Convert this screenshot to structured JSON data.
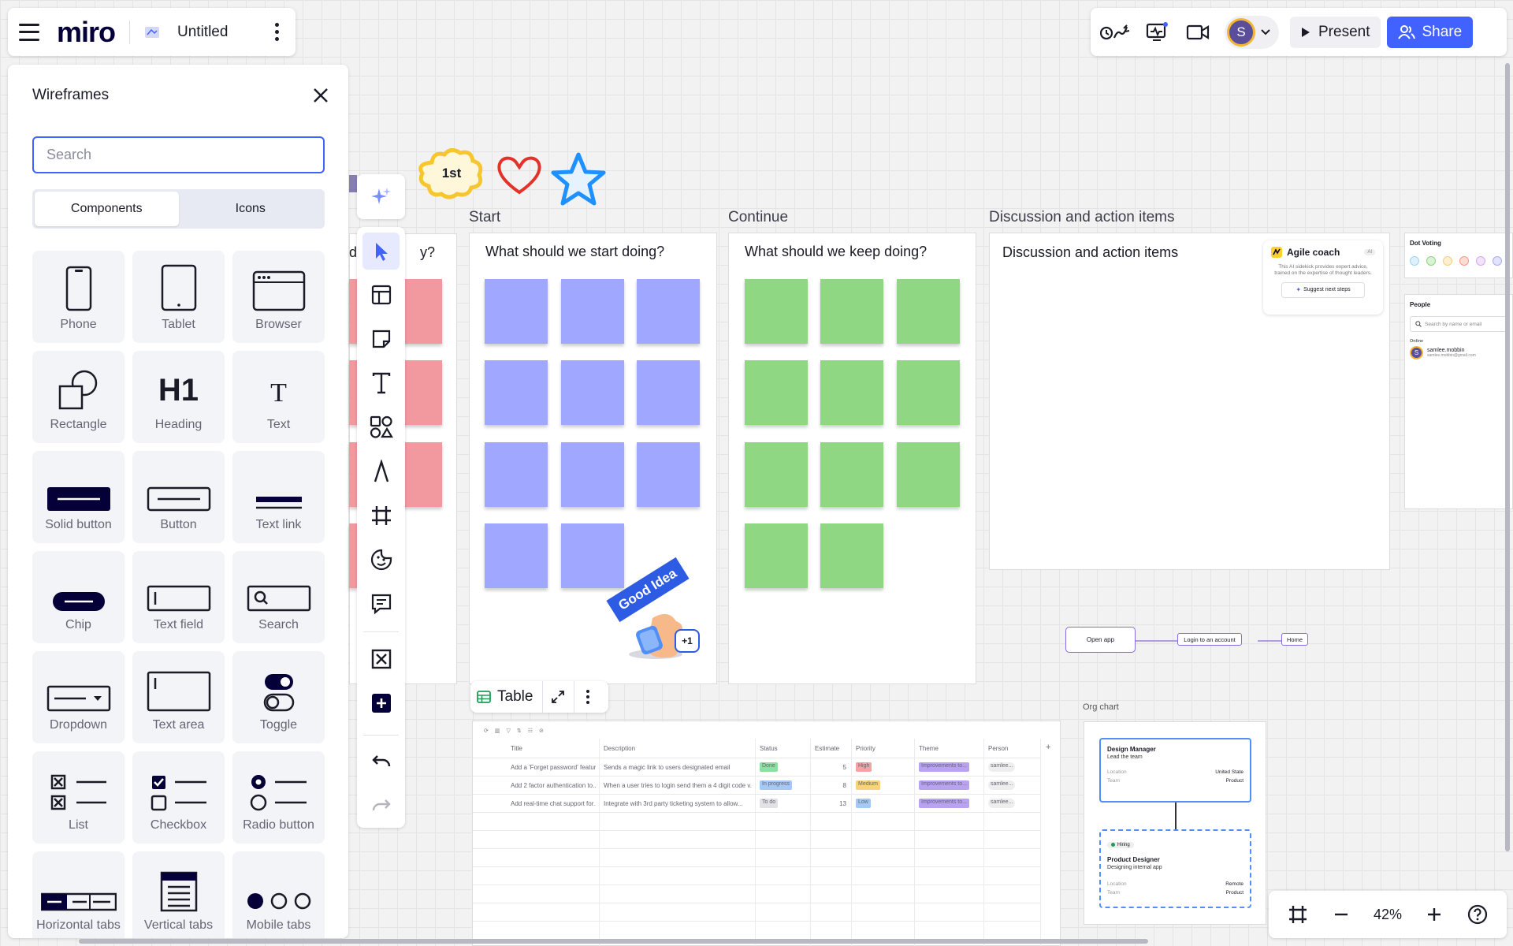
{
  "app": {
    "logo": "miro",
    "board_title": "Untitled"
  },
  "topbar": {
    "present_label": "Present",
    "share_label": "Share",
    "avatar_initial": "S"
  },
  "panel": {
    "title": "Wireframes",
    "search_placeholder": "Search",
    "tabs": [
      "Components",
      "Icons"
    ],
    "active_tab": "Components",
    "components": [
      {
        "label": "Phone",
        "icon": "phone-icon"
      },
      {
        "label": "Tablet",
        "icon": "tablet-icon"
      },
      {
        "label": "Browser",
        "icon": "browser-icon"
      },
      {
        "label": "Rectangle",
        "icon": "rectangle-icon"
      },
      {
        "label": "Heading",
        "icon": "heading-icon"
      },
      {
        "label": "Text",
        "icon": "text-icon"
      },
      {
        "label": "Solid button",
        "icon": "solid-button-icon"
      },
      {
        "label": "Button",
        "icon": "button-icon"
      },
      {
        "label": "Text link",
        "icon": "text-link-icon"
      },
      {
        "label": "Chip",
        "icon": "chip-icon"
      },
      {
        "label": "Text field",
        "icon": "text-field-icon"
      },
      {
        "label": "Search",
        "icon": "search-field-icon"
      },
      {
        "label": "Dropdown",
        "icon": "dropdown-icon"
      },
      {
        "label": "Text area",
        "icon": "text-area-icon"
      },
      {
        "label": "Toggle",
        "icon": "toggle-icon"
      },
      {
        "label": "List",
        "icon": "list-icon"
      },
      {
        "label": "Checkbox",
        "icon": "checkbox-icon"
      },
      {
        "label": "Radio button",
        "icon": "radio-button-icon"
      },
      {
        "label": "Horizontal tabs",
        "icon": "horizontal-tabs-icon"
      },
      {
        "label": "Vertical tabs",
        "icon": "vertical-tabs-icon"
      },
      {
        "label": "Mobile tabs",
        "icon": "mobile-tabs-icon"
      }
    ],
    "heading_glyph": "H1",
    "text_glyph": "T"
  },
  "canvas": {
    "partial_frame_heading": "d                y?",
    "stickers": {
      "first": "1st"
    },
    "frames": [
      {
        "title": "Start",
        "heading": "What should we start doing?"
      },
      {
        "title": "Continue",
        "heading": "What should we keep doing?"
      },
      {
        "title": "Discussion and action items",
        "heading": "Discussion and action items"
      }
    ],
    "good_idea": {
      "text": "Good Idea",
      "count": "+1"
    },
    "agile_coach": {
      "title": "Agile coach",
      "badge": "AI",
      "desc": "This AI sidekick provides expert advice, trained on the expertise of thought leaders.",
      "button": "Suggest next steps"
    },
    "dot_voting": {
      "title": "Dot Voting",
      "colors": [
        "#9fd3f5",
        "#8fd782",
        "#f7cf7a",
        "#f59a7f",
        "#d7a8f0",
        "#a9aaf5"
      ]
    },
    "people": {
      "title": "People",
      "search_placeholder": "Search by name or email",
      "online_label": "Online",
      "user_name": "samlee.mobbin",
      "user_email": "samlee.mobbin@gmail.com"
    },
    "flow": [
      "Open app",
      "Login to an account",
      "Home"
    ],
    "org_chart": {
      "label": "Org chart",
      "manager": {
        "title": "Design Manager",
        "subtitle": "Lead the team",
        "location_label": "Location",
        "location": "United State",
        "team_label": "Team",
        "team": "Product"
      },
      "designer": {
        "badge": "Hiring",
        "title": "Product Designer",
        "subtitle": "Designing internal app",
        "location_label": "Location",
        "location": "Remote",
        "team_label": "Team",
        "team": "Product"
      }
    },
    "table": {
      "chip_label": "Table",
      "columns": [
        "Title",
        "Description",
        "Status",
        "Estimate",
        "Priority",
        "Theme",
        "Person"
      ],
      "rows": [
        {
          "title": "Add a 'Forget password' featur...",
          "description": "Sends a magic link to users designated email",
          "status": "Done",
          "status_color": "#8fe0a0",
          "estimate": "5",
          "priority": "High",
          "priority_color": "#f4a4a4",
          "theme": "Improvements to...",
          "person": "samlee..."
        },
        {
          "title": "Add 2 factor authentication to...",
          "description": "When a user tries to login send them a 4 digit code v...",
          "status": "In progress",
          "status_color": "#a6c8f5",
          "estimate": "8",
          "priority": "Medium",
          "priority_color": "#f7d47a",
          "theme": "Improvements to...",
          "person": "samlee..."
        },
        {
          "title": "Add real-time chat support for...",
          "description": "Integrate with 3rd party ticketing system to allow...",
          "status": "To do",
          "status_color": "#e2e2e6",
          "estimate": "13",
          "priority": "Low",
          "priority_color": "#a6c8f5",
          "theme": "Improvements to...",
          "person": "samlee..."
        }
      ]
    }
  },
  "zoom": {
    "value": "42%"
  }
}
